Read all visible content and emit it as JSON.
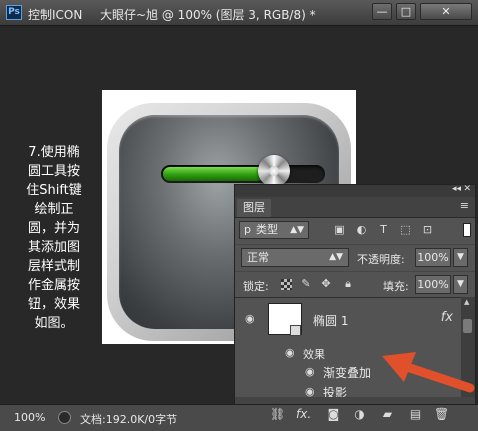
{
  "titlebar": {
    "app_logo": "Ps",
    "app_title": "控制ICON",
    "document_title": "大眼仔~旭 @ 100% (图层 3, RGB/8) *",
    "buttons": {
      "minimize": "—",
      "maximize": "□",
      "close": "✕"
    }
  },
  "instruction": {
    "lines": [
      "7.使用椭",
      "圆工具按",
      "住Shift键",
      "绘制正",
      "圆，并为",
      "其添加图",
      "层样式制",
      "作金属按",
      "钮，效果",
      "如图。"
    ]
  },
  "artwork": {
    "slider_progress": 0.63,
    "fill_color": "#3aa51a"
  },
  "statusbar": {
    "zoom": "100%",
    "doc_info": "文档:192.0K/0字节"
  },
  "layers_panel": {
    "top_collapse": "◂◂",
    "top_close": "✕",
    "tab_label": "图层",
    "menu_icon": "≡",
    "filter": {
      "icon": "p",
      "kind_label": "类型",
      "arrow": "▲▼"
    },
    "filter_icons": [
      "image-filter-icon",
      "adjustment-filter-icon",
      "type-filter-icon",
      "shape-filter-icon",
      "smart-object-filter-icon"
    ],
    "blend_mode": "正常",
    "opacity_label": "不透明度:",
    "opacity_value": "100%",
    "lock_label": "锁定:",
    "fill_label": "填充:",
    "fill_value": "100%",
    "layer": {
      "name": "椭圆 1",
      "fx": "fx"
    },
    "effects_label": "效果",
    "effect_items": [
      "渐变叠加",
      "投影"
    ]
  },
  "bottom_toolbar": {
    "icons": [
      "link-layers-icon",
      "add-style-icon",
      "add-mask-icon",
      "adjustment-layer-icon",
      "new-group-icon",
      "new-layer-icon",
      "delete-layer-icon"
    ],
    "fx_text": "fx."
  },
  "colors": {
    "annotation_arrow": "#e0502a",
    "panel_bg": "#535353",
    "canvas_bg": "#282828"
  }
}
